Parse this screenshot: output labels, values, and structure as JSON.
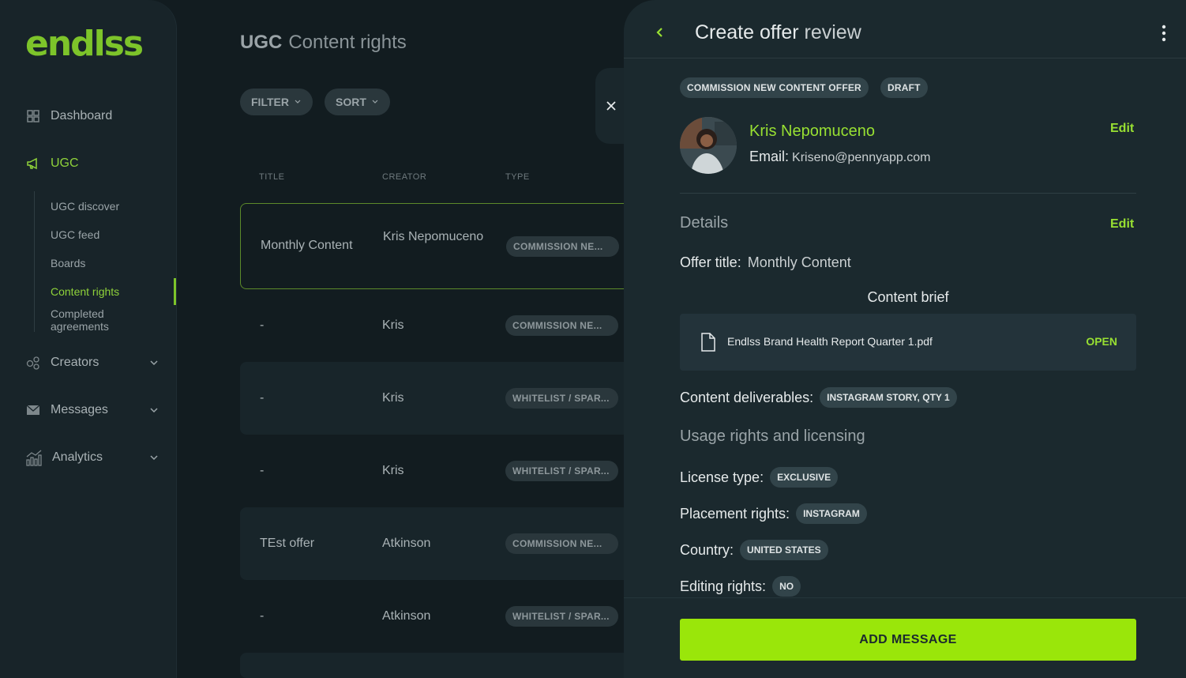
{
  "brand": {
    "logo_text": "endlss",
    "accent": "#98e032",
    "button_color": "#9ae60a"
  },
  "sidebar": {
    "items": [
      {
        "label": "Dashboard",
        "icon": "grid-icon"
      },
      {
        "label": "UGC",
        "icon": "megaphone-icon"
      },
      {
        "label": "Creators",
        "icon": "users-icon"
      },
      {
        "label": "Messages",
        "icon": "mail-icon"
      },
      {
        "label": "Analytics",
        "icon": "chart-icon"
      }
    ],
    "ugc_sub": [
      "UGC discover",
      "UGC feed",
      "Boards",
      "Content rights",
      "Completed agreements"
    ]
  },
  "main": {
    "title_bold": "UGC",
    "title_light": "Content rights",
    "filter_label": "FILTER",
    "sort_label": "SORT",
    "columns": [
      "TITLE",
      "CREATOR",
      "TYPE"
    ],
    "rows": [
      {
        "title": "Monthly Content",
        "creator": "Kris Nepomuceno",
        "type": "COMMISSION NE..."
      },
      {
        "title": "-",
        "creator": "Kris",
        "type": "COMMISSION NE..."
      },
      {
        "title": "-",
        "creator": "Kris",
        "type": "WHITELIST / SPAR..."
      },
      {
        "title": "-",
        "creator": "Kris",
        "type": "WHITELIST / SPAR..."
      },
      {
        "title": "TEst offer",
        "creator": "Atkinson",
        "type": "COMMISSION NE..."
      },
      {
        "title": "-",
        "creator": "Atkinson",
        "type": "WHITELIST / SPAR..."
      }
    ]
  },
  "panel": {
    "title_bold": "Create offer",
    "title_light": "review",
    "tags": [
      "COMMISSION NEW CONTENT OFFER",
      "DRAFT"
    ],
    "creator": {
      "name": "Kris Nepomuceno",
      "email_label": "Email:",
      "email": "Kriseno@pennyapp.com",
      "edit": "Edit"
    },
    "details": {
      "heading": "Details",
      "edit": "Edit",
      "offer_title_label": "Offer title:",
      "offer_title": "Monthly Content",
      "brief_heading": "Content brief",
      "file_name": "Endlss Brand Health Report Quarter 1.pdf",
      "file_action": "OPEN",
      "deliverables_label": "Content deliverables:",
      "deliverables": "INSTAGRAM STORY, QTY 1"
    },
    "usage": {
      "heading": "Usage rights and licensing",
      "license_label": "License type:",
      "license": "EXCLUSIVE",
      "placement_label": "Placement rights:",
      "placement": "INSTAGRAM",
      "country_label": "Country:",
      "country": "UNITED STATES",
      "editing_label": "Editing rights:",
      "editing": "NO"
    },
    "add_message": "ADD MESSAGE"
  }
}
